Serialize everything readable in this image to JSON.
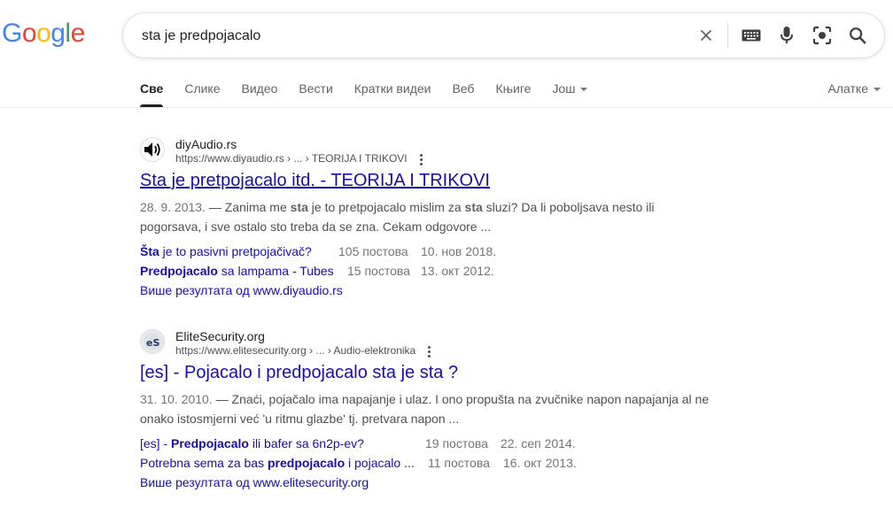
{
  "logo": {
    "letters": [
      "G",
      "o",
      "o",
      "g",
      "l",
      "e"
    ],
    "colors": [
      "#4285F4",
      "#EA4335",
      "#FBBC05",
      "#4285F4",
      "#34A853",
      "#EA4335"
    ]
  },
  "search": {
    "query": "sta je predpojacalo"
  },
  "tabs": [
    {
      "label": "Све"
    },
    {
      "label": "Слике"
    },
    {
      "label": "Видео"
    },
    {
      "label": "Вести"
    },
    {
      "label": "Кратки видеи"
    },
    {
      "label": "Веб"
    },
    {
      "label": "Књиге"
    },
    {
      "label": "Још"
    }
  ],
  "tools_label": "Алатке",
  "results": [
    {
      "site_name": "diyAudio.rs",
      "url": "https://www.diyaudio.rs › ... › TEORIJA I TRIKOVI",
      "title": "Sta je pretpojacalo itd. - TEORIJA I TRIKOVI",
      "date": "28. 9. 2013.",
      "snippet_parts": [
        " — Zanima me ",
        "sta",
        " je to pretpojacalo mislim za ",
        "sta",
        " sluzi? Da li poboljsava nesto ili pogorsava, i sve ostalo sto treba da se zna. Cekam odgovore ..."
      ],
      "sublinks": [
        {
          "parts": [
            "Šta",
            " je to pasivni pretpojačivač?"
          ],
          "count": "105 постова",
          "date": "10. нов 2018."
        },
        {
          "parts": [
            "Predpojacalo",
            " sa lampama - Tubes"
          ],
          "count": "15 постова",
          "date": "13. окт 2012."
        }
      ],
      "more": "Више резултата од www.diyaudio.rs"
    },
    {
      "site_name": "EliteSecurity.org",
      "url": "https://www.elitesecurity.org › ... › Audio-elektronika",
      "title": "[es] - Pojacalo i predpojacalo sta je sta ?",
      "date": "31. 10. 2010.",
      "snippet_parts": [
        " — Znaći, pojačalo ima napajanje i ulaz. I ono propušta na zvučnike napon napajanja al ne onako istosmjerni već 'u ritmu glazbe' tj. pretvara napon ..."
      ],
      "sublinks": [
        {
          "parts": [
            "[es] - ",
            "Predpojacalo",
            " ili bafer sa 6n2p-ev?"
          ],
          "count": "19 постова",
          "date": "22. сеп 2014."
        },
        {
          "parts": [
            "Potrebna sema za bas ",
            "predpojacalo",
            " i pojacalo ..."
          ],
          "count": "11 постова",
          "date": "16. окт 2013."
        }
      ],
      "more": "Више резултата од www.elitesecurity.org"
    }
  ]
}
